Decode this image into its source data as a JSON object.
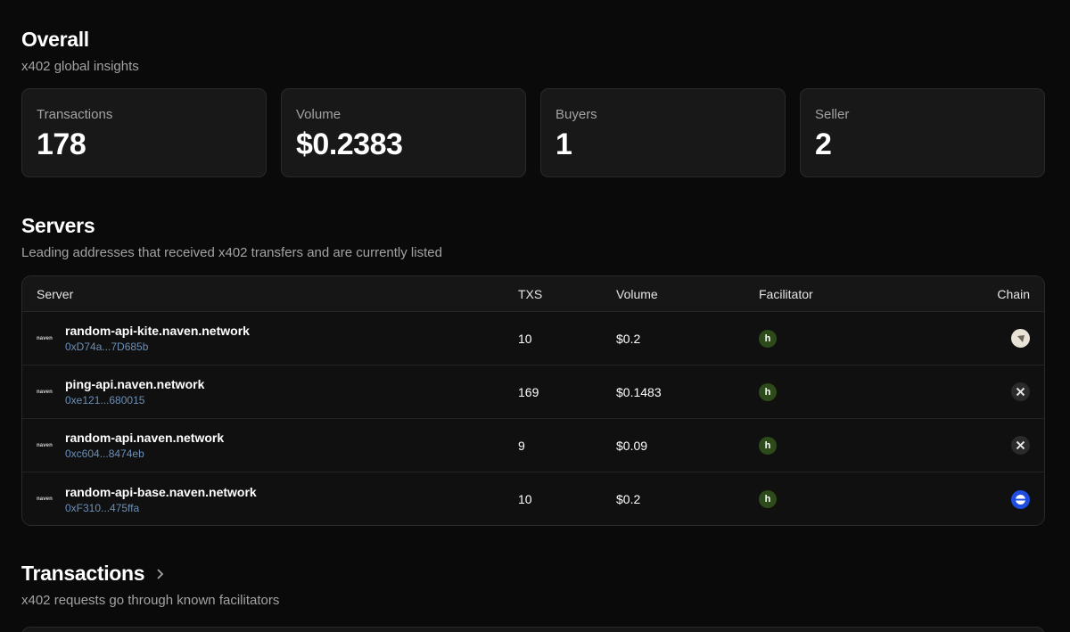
{
  "overall": {
    "title": "Overall",
    "subtitle": "x402 global insights"
  },
  "stats": [
    {
      "label": "Transactions",
      "value": "178"
    },
    {
      "label": "Volume",
      "value": "$0.2383"
    },
    {
      "label": "Buyers",
      "value": "1"
    },
    {
      "label": "Seller",
      "value": "2"
    }
  ],
  "servers": {
    "title": "Servers",
    "subtitle": "Leading addresses that received x402 transfers and are currently listed",
    "columns": {
      "server": "Server",
      "txs": "TXS",
      "volume": "Volume",
      "facilitator": "Facilitator",
      "chain": "Chain"
    },
    "rows": [
      {
        "logo": "naven",
        "name": "random-api-kite.naven.network",
        "address": "0xD74a...7D685b",
        "txs": "10",
        "volume": "$0.2",
        "facilitator_icon": "h",
        "chain_icon": "kite-chain-icon"
      },
      {
        "logo": "naven",
        "name": "ping-api.naven.network",
        "address": "0xe121...680015",
        "txs": "169",
        "volume": "$0.1483",
        "facilitator_icon": "h",
        "chain_icon": "x-chain-icon"
      },
      {
        "logo": "naven",
        "name": "random-api.naven.network",
        "address": "0xc604...8474eb",
        "txs": "9",
        "volume": "$0.09",
        "facilitator_icon": "h",
        "chain_icon": "x-chain-icon"
      },
      {
        "logo": "naven",
        "name": "random-api-base.naven.network",
        "address": "0xF310...475ffa",
        "txs": "10",
        "volume": "$0.2",
        "facilitator_icon": "h",
        "chain_icon": "base-chain-icon"
      }
    ]
  },
  "transactions": {
    "title": "Transactions",
    "subtitle": "x402 requests go through known facilitators"
  },
  "colors": {
    "background": "#0a0a0a",
    "card": "#181818",
    "muted_text": "#a3a3a3",
    "address_text": "#6b8fb8",
    "facilitator_badge": "#2c4a1a",
    "base_chain": "#1f4de0"
  }
}
